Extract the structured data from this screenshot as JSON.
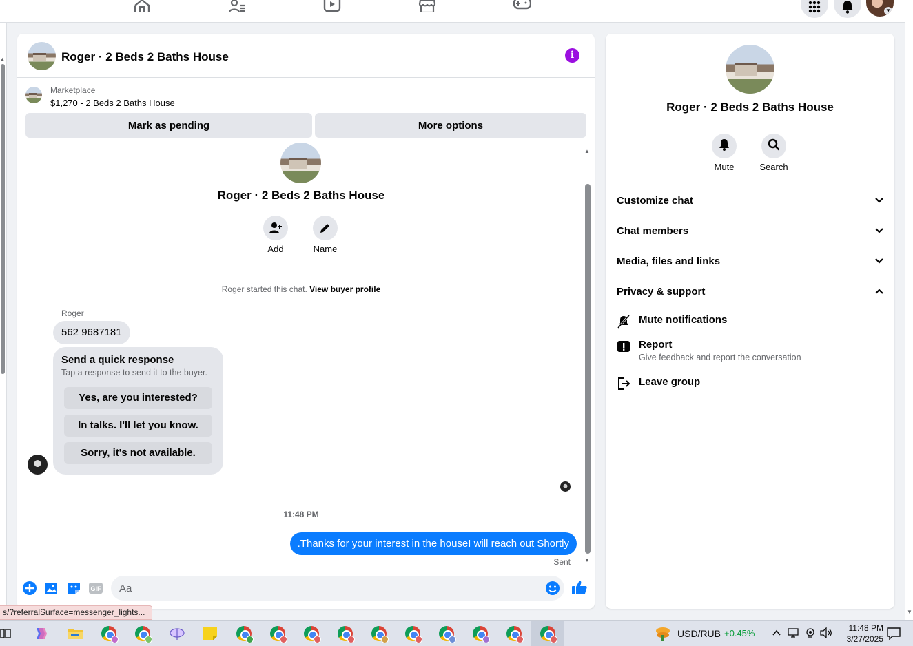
{
  "top_nav": {
    "icons": [
      "home-icon",
      "friends-icon",
      "video-icon",
      "marketplace-icon",
      "gaming-icon",
      "menu-grid-icon",
      "notifications-icon",
      "account-avatar"
    ]
  },
  "chat": {
    "header_title": "Roger · 2 Beds 2 Baths House",
    "marketplace": {
      "label": "Marketplace",
      "listing": "$1,270 - 2 Beds 2 Baths House",
      "mark_pending": "Mark as pending",
      "more_options": "More options"
    },
    "intro": {
      "title": "Roger · 2 Beds 2 Baths House",
      "add_label": "Add",
      "name_label": "Name",
      "started_text": "Roger started this chat.",
      "view_profile": "View buyer profile"
    },
    "messages": {
      "sender": "Roger",
      "phone": "562 9687181",
      "quick_response": {
        "title": "Send a quick response",
        "subtitle": "Tap a response to send it to the buyer.",
        "options": [
          "Yes, are you interested?",
          "In talks. I'll let you know.",
          "Sorry, it's not available."
        ]
      },
      "timestamp": "11:48 PM",
      "my_message": ".Thanks for your interest in the houseI will reach out Shortly",
      "status": "Sent"
    },
    "composer": {
      "placeholder": "Aa",
      "value": ""
    },
    "status_url": "s/?referralSurface=messenger_lights..."
  },
  "info_panel": {
    "title": "Roger · 2 Beds 2 Baths House",
    "mute_label": "Mute",
    "search_label": "Search",
    "sections": [
      "Customize chat",
      "Chat members",
      "Media, files and links",
      "Privacy & support"
    ],
    "privacy_items": {
      "mute": "Mute notifications",
      "report": "Report",
      "report_sub": "Give feedback and report the conversation",
      "leave": "Leave group"
    }
  },
  "taskbar": {
    "ticker": "USD/RUB",
    "ticker_change": "+0.45%",
    "time": "11:48 PM",
    "date": "3/27/2025"
  },
  "colors": {
    "accent": "#0a7cff",
    "info": "#9b0fe0",
    "ticker_up": "#0a9d3b"
  }
}
